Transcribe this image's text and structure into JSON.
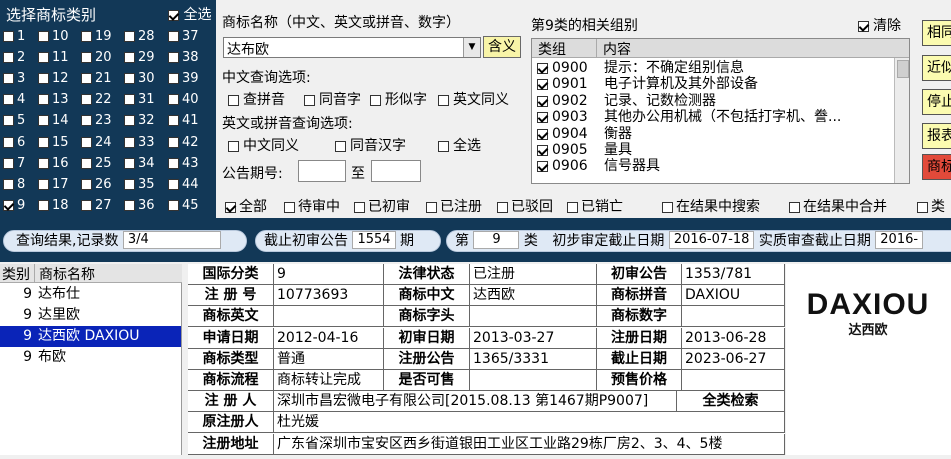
{
  "categories": {
    "title": "选择商标类别",
    "all_label": "全选",
    "all_checked": true,
    "items": [
      {
        "n": "1",
        "checked": false
      },
      {
        "n": "2",
        "checked": false
      },
      {
        "n": "3",
        "checked": false
      },
      {
        "n": "4",
        "checked": false
      },
      {
        "n": "5",
        "checked": false
      },
      {
        "n": "6",
        "checked": false
      },
      {
        "n": "7",
        "checked": false
      },
      {
        "n": "8",
        "checked": false
      },
      {
        "n": "9",
        "checked": true
      },
      {
        "n": "10",
        "checked": false
      },
      {
        "n": "11",
        "checked": false
      },
      {
        "n": "12",
        "checked": false
      },
      {
        "n": "13",
        "checked": false
      },
      {
        "n": "14",
        "checked": false
      },
      {
        "n": "15",
        "checked": false
      },
      {
        "n": "16",
        "checked": false
      },
      {
        "n": "17",
        "checked": false
      },
      {
        "n": "18",
        "checked": false
      },
      {
        "n": "19",
        "checked": false
      },
      {
        "n": "20",
        "checked": false
      },
      {
        "n": "21",
        "checked": false
      },
      {
        "n": "22",
        "checked": false
      },
      {
        "n": "23",
        "checked": false
      },
      {
        "n": "24",
        "checked": false
      },
      {
        "n": "25",
        "checked": false
      },
      {
        "n": "26",
        "checked": false
      },
      {
        "n": "27",
        "checked": false
      },
      {
        "n": "28",
        "checked": false
      },
      {
        "n": "29",
        "checked": false
      },
      {
        "n": "30",
        "checked": false
      },
      {
        "n": "31",
        "checked": false
      },
      {
        "n": "32",
        "checked": false
      },
      {
        "n": "33",
        "checked": false
      },
      {
        "n": "34",
        "checked": false
      },
      {
        "n": "35",
        "checked": false
      },
      {
        "n": "36",
        "checked": false
      },
      {
        "n": "37",
        "checked": false
      },
      {
        "n": "38",
        "checked": false
      },
      {
        "n": "39",
        "checked": false
      },
      {
        "n": "40",
        "checked": false
      },
      {
        "n": "41",
        "checked": false
      },
      {
        "n": "42",
        "checked": false
      },
      {
        "n": "43",
        "checked": false
      },
      {
        "n": "44",
        "checked": false
      },
      {
        "n": "45",
        "checked": false
      }
    ]
  },
  "query": {
    "name_label": "商标名称（中文、英文或拼音、数字）",
    "name_value": "达布欧",
    "meaning_btn": "含义",
    "cn_options_label": "中文查询选项:",
    "cn_options": [
      "查拼音",
      "同音字",
      "形似字",
      "英文同义"
    ],
    "en_options_label": "英文或拼音查询选项:",
    "en_options": [
      "中文同义",
      "同音汉字",
      "全选"
    ],
    "pub_label": "公告期号:",
    "to_label": "至"
  },
  "groups": {
    "title": "第9类的相关组别",
    "clear_label": "清除",
    "clear_checked": true,
    "col_group": "类组",
    "col_content": "内容",
    "rows": [
      {
        "code": "0900",
        "desc": "提示：不确定组别信息"
      },
      {
        "code": "0901",
        "desc": "电子计算机及其外部设备"
      },
      {
        "code": "0902",
        "desc": "记录、记数检测器"
      },
      {
        "code": "0903",
        "desc": "其他办公用机械（不包括打字机、誊..."
      },
      {
        "code": "0904",
        "desc": "衡器"
      },
      {
        "code": "0905",
        "desc": "量具"
      },
      {
        "code": "0906",
        "desc": "信号器具"
      }
    ]
  },
  "right_buttons": [
    {
      "label": "相同",
      "color": "#fbfbb0"
    },
    {
      "label": "近似",
      "color": "#fbfbb0"
    },
    {
      "label": "停止",
      "color": "#fbfbb0"
    },
    {
      "label": "报表",
      "color": "#fbfbb0"
    },
    {
      "label": "商标",
      "color": "#e24a3a"
    }
  ],
  "status_filters": [
    {
      "label": "全部",
      "checked": true
    },
    {
      "label": "待审中",
      "checked": false
    },
    {
      "label": "已初审",
      "checked": false
    },
    {
      "label": "已注册",
      "checked": false
    },
    {
      "label": "已驳回",
      "checked": false
    },
    {
      "label": "已销亡",
      "checked": false
    },
    {
      "label": "在结果中搜索",
      "checked": false
    },
    {
      "label": "在结果中合并",
      "checked": false
    },
    {
      "label": "类",
      "checked": false
    }
  ],
  "bar": {
    "result_label": "查询结果,记录数",
    "result_count": "3/4",
    "cutoff_label": "截止初审公告",
    "cutoff_value": "1554",
    "cutoff_unit": "期",
    "class_prefix": "第",
    "class_value": "9",
    "class_suffix": "类",
    "prelim_label": "初步审定截止日期",
    "prelim_date": "2016-07-18",
    "exam_label": "实质审查截止日期",
    "exam_date": "2016-"
  },
  "results": {
    "col_class": "类别",
    "col_name": "商标名称",
    "rows": [
      {
        "cls": "9",
        "name": "达布仕",
        "selected": false
      },
      {
        "cls": "9",
        "name": "达里欧",
        "selected": false
      },
      {
        "cls": "9",
        "name": "达西欧 DAXIOU",
        "selected": true
      },
      {
        "cls": "9",
        "name": "布欧",
        "selected": false
      }
    ]
  },
  "detail": {
    "intl_class_k": "国际分类",
    "intl_class_v": "9",
    "legal_status_k": "法律状态",
    "legal_status_v": "已注册",
    "prelim_pub_k": "初审公告",
    "prelim_pub_v": "1353/781",
    "reg_no_k": "注 册 号",
    "reg_no_v": "10773693",
    "cn_name_k": "商标中文",
    "cn_name_v": "达西欧",
    "pinyin_k": "商标拼音",
    "pinyin_v": "DAXIOU",
    "en_name_k": "商标英文",
    "en_name_v": "",
    "initial_k": "商标字头",
    "initial_v": "",
    "digits_k": "商标数字",
    "digits_v": "",
    "apply_date_k": "申请日期",
    "apply_date_v": "2012-04-16",
    "prelim_date_k": "初审日期",
    "prelim_date_v": "2013-03-27",
    "reg_date_k": "注册日期",
    "reg_date_v": "2013-06-28",
    "type_k": "商标类型",
    "type_v": "普通",
    "reg_pub_k": "注册公告",
    "reg_pub_v": "1365/3331",
    "expiry_k": "截止日期",
    "expiry_v": "2023-06-27",
    "flow_k": "商标流程",
    "flow_v": "商标转让完成",
    "sellable_k": "是否可售",
    "sellable_v": "",
    "presale_k": "预售价格",
    "presale_v": "",
    "registrant_k": "注 册 人",
    "registrant_v": "深圳市昌宏微电子有限公司[2015.08.13 第1467期P9007]",
    "full_search": "全类检索",
    "orig_registrant_k": "原注册人",
    "orig_registrant_v": "杜光媛",
    "address_k": "注册地址",
    "address_v": "广东省深圳市宝安区西乡街道银田工业区工业路29栋厂房2、3、4、5楼"
  },
  "logo": {
    "latin": "DAXIOU",
    "chinese": "达西欧"
  }
}
